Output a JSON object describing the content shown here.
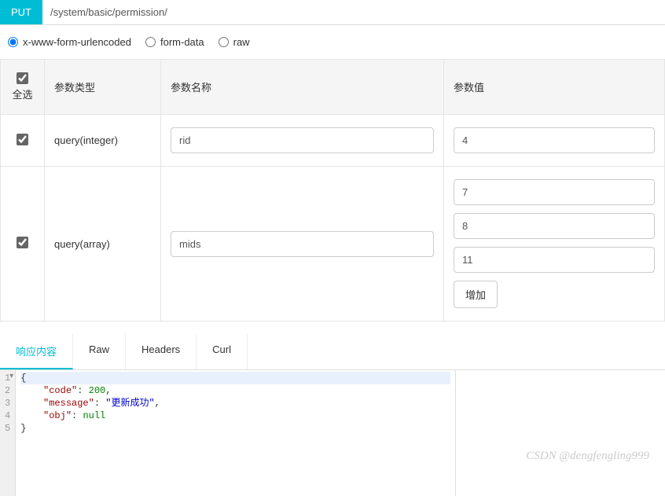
{
  "request": {
    "method": "PUT",
    "url": "/system/basic/permission/"
  },
  "body_types": {
    "selected": "x-www-form-urlencoded",
    "options": [
      "x-www-form-urlencoded",
      "form-data",
      "raw"
    ]
  },
  "table": {
    "headers": {
      "select_all": "全选",
      "param_type": "参数类型",
      "param_name": "参数名称",
      "param_value": "参数值"
    },
    "rows": [
      {
        "checked": true,
        "type": "query(integer)",
        "name": "rid",
        "values": [
          "4"
        ]
      },
      {
        "checked": true,
        "type": "query(array)",
        "name": "mids",
        "values": [
          "7",
          "8",
          "11"
        ],
        "add_label": "增加"
      }
    ]
  },
  "response": {
    "tabs": [
      "响应内容",
      "Raw",
      "Headers",
      "Curl"
    ],
    "active_tab": 0,
    "body": {
      "code": 200,
      "message": "更新成功",
      "obj": null
    }
  },
  "watermark": "CSDN @dengfengling999"
}
